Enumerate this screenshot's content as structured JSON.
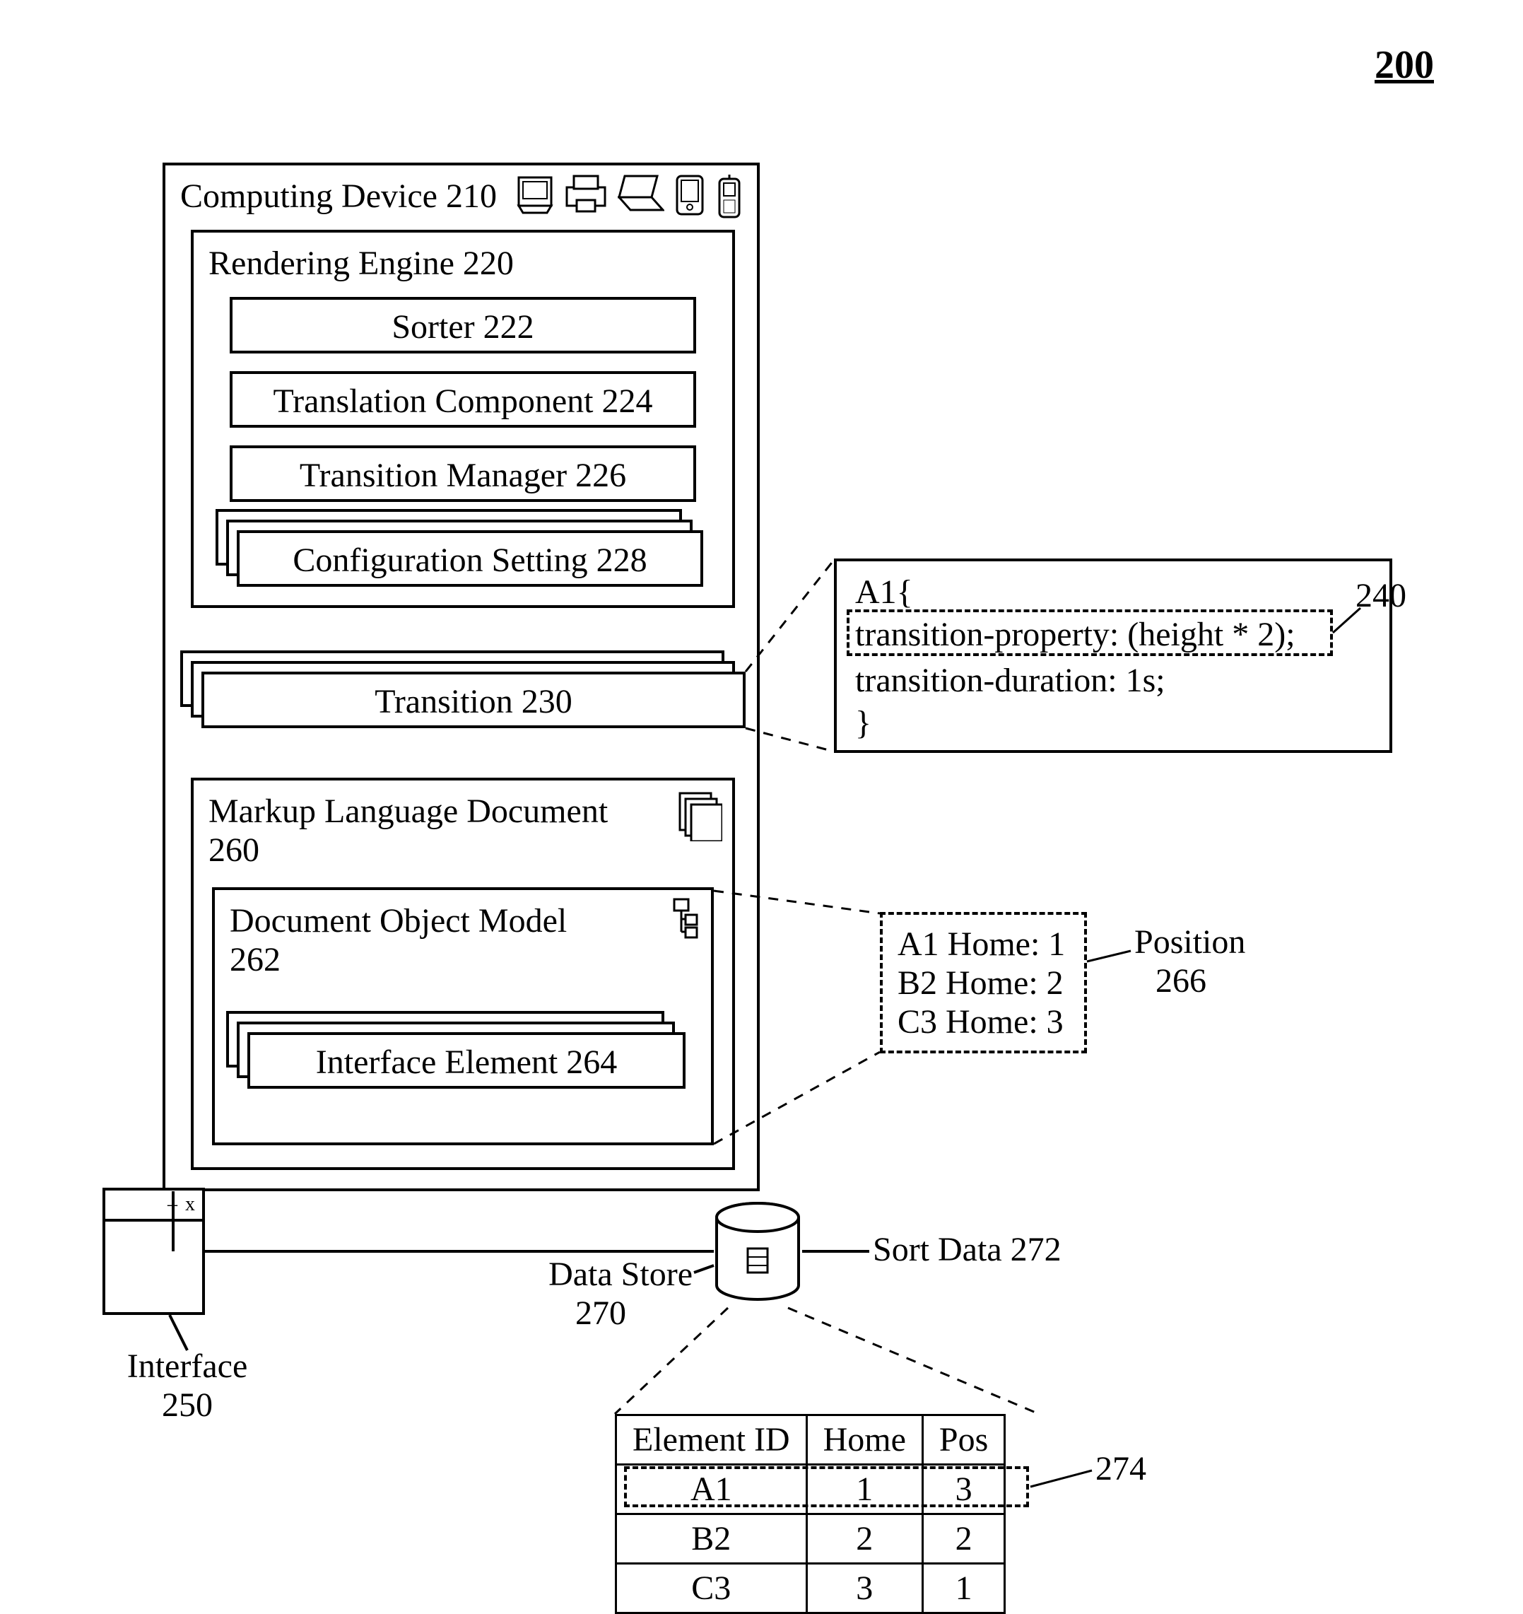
{
  "figure_number": "200",
  "computing_device": {
    "title": "Computing Device 210"
  },
  "rendering_engine": {
    "title": "Rendering Engine 220",
    "sorter": "Sorter 222",
    "translation": "Translation Component 224",
    "transition_mgr": "Transition Manager 226",
    "config_setting": "Configuration Setting 228"
  },
  "transition": {
    "title": "Transition 230"
  },
  "code_box": {
    "line1": "A1{",
    "line2": "transition-property: (height * 2);",
    "line3": "transition-duration: 1s;",
    "line4": "}",
    "ref": "240"
  },
  "markup_doc": {
    "title_l1": "Markup Language Document",
    "title_l2": "260"
  },
  "dom": {
    "title_l1": "Document Object Model",
    "title_l2": "262",
    "interface_element": "Interface Element 264"
  },
  "position_box": {
    "rows": [
      "A1 Home: 1",
      "B2 Home: 2",
      "C3 Home: 3"
    ],
    "label_l1": "Position",
    "label_l2": "266"
  },
  "interface": {
    "label_l1": "Interface",
    "label_l2": "250"
  },
  "data_store": {
    "label_l1": "Data Store",
    "label_l2": "270"
  },
  "sort_data": {
    "label": "Sort Data 272"
  },
  "sort_table": {
    "headers": [
      "Element ID",
      "Home",
      "Pos"
    ],
    "rows": [
      [
        "A1",
        "1",
        "3"
      ],
      [
        "B2",
        "2",
        "2"
      ],
      [
        "C3",
        "3",
        "1"
      ]
    ],
    "row_ref": "274"
  }
}
